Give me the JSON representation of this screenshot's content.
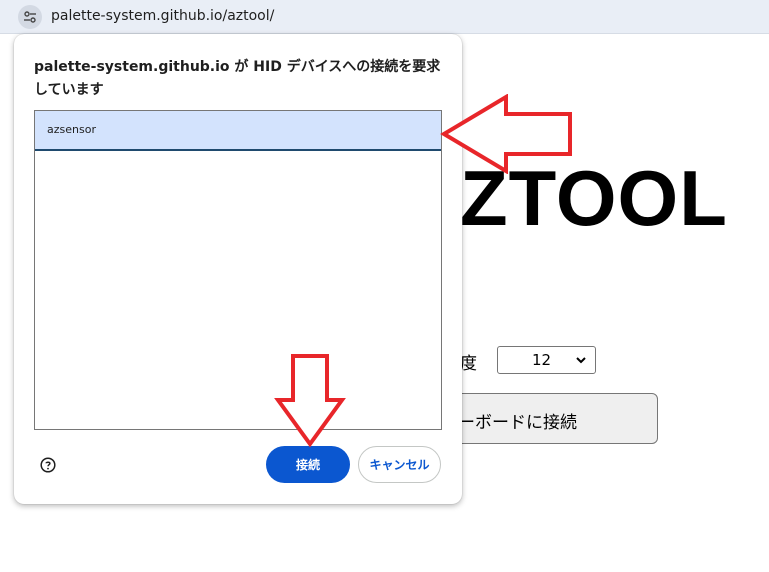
{
  "browser": {
    "url": "palette-system.github.io/aztool/",
    "site_info_icon": "tune-icon"
  },
  "page": {
    "title_fragment": "ZTOOL",
    "speed_label_fragment": "度",
    "speed_value": "12",
    "connect_button_fragment": "ーボードに接続"
  },
  "dialog": {
    "title": "palette-system.github.io が HID デバイスへの接続を要求しています",
    "devices": [
      {
        "name": "azsensor",
        "selected": true
      }
    ],
    "help_icon": "help-circle-icon",
    "connect_label": "接続",
    "cancel_label": "キャンセル"
  },
  "annotations": {
    "arrow_color": "#e8262a",
    "accent_color": "#0b57d0",
    "selected_row_color": "#d3e3fd"
  }
}
